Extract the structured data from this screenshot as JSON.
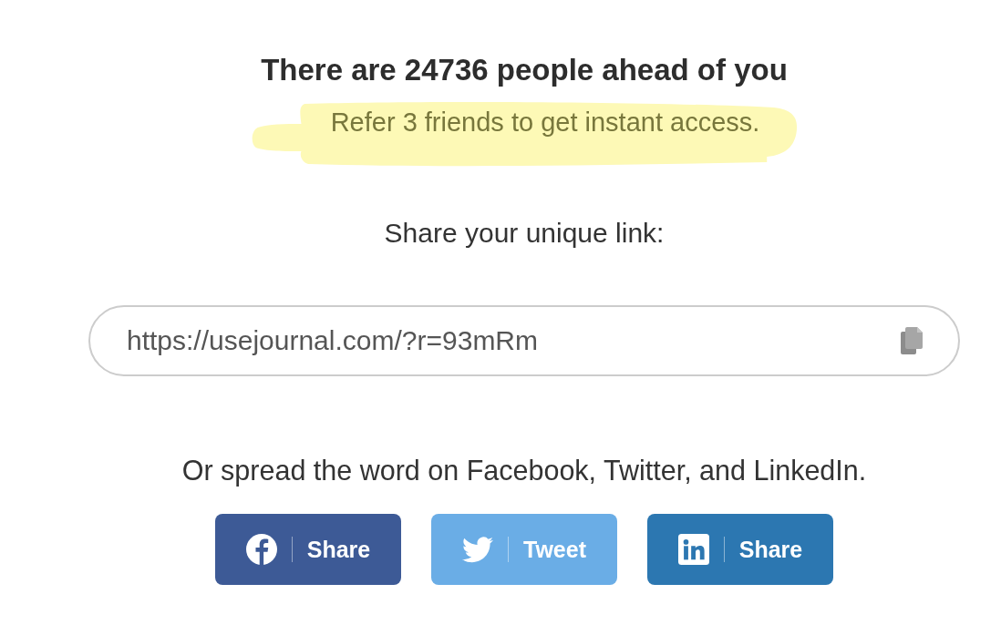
{
  "heading": "There are 24736 people ahead of you",
  "referral_note": "Refer 3 friends to get instant access.",
  "share_prompt": "Share your unique link:",
  "link_field": {
    "value": "https://usejournal.com/?r=93mRm"
  },
  "social_prompt": "Or spread the word on Facebook, Twitter, and LinkedIn.",
  "share_buttons": [
    {
      "kind": "facebook",
      "label": "Share",
      "color": "#3d5a96"
    },
    {
      "kind": "twitter",
      "label": "Tweet",
      "color": "#6aade6"
    },
    {
      "kind": "linkedin",
      "label": "Share",
      "color": "#2c77b1"
    }
  ]
}
